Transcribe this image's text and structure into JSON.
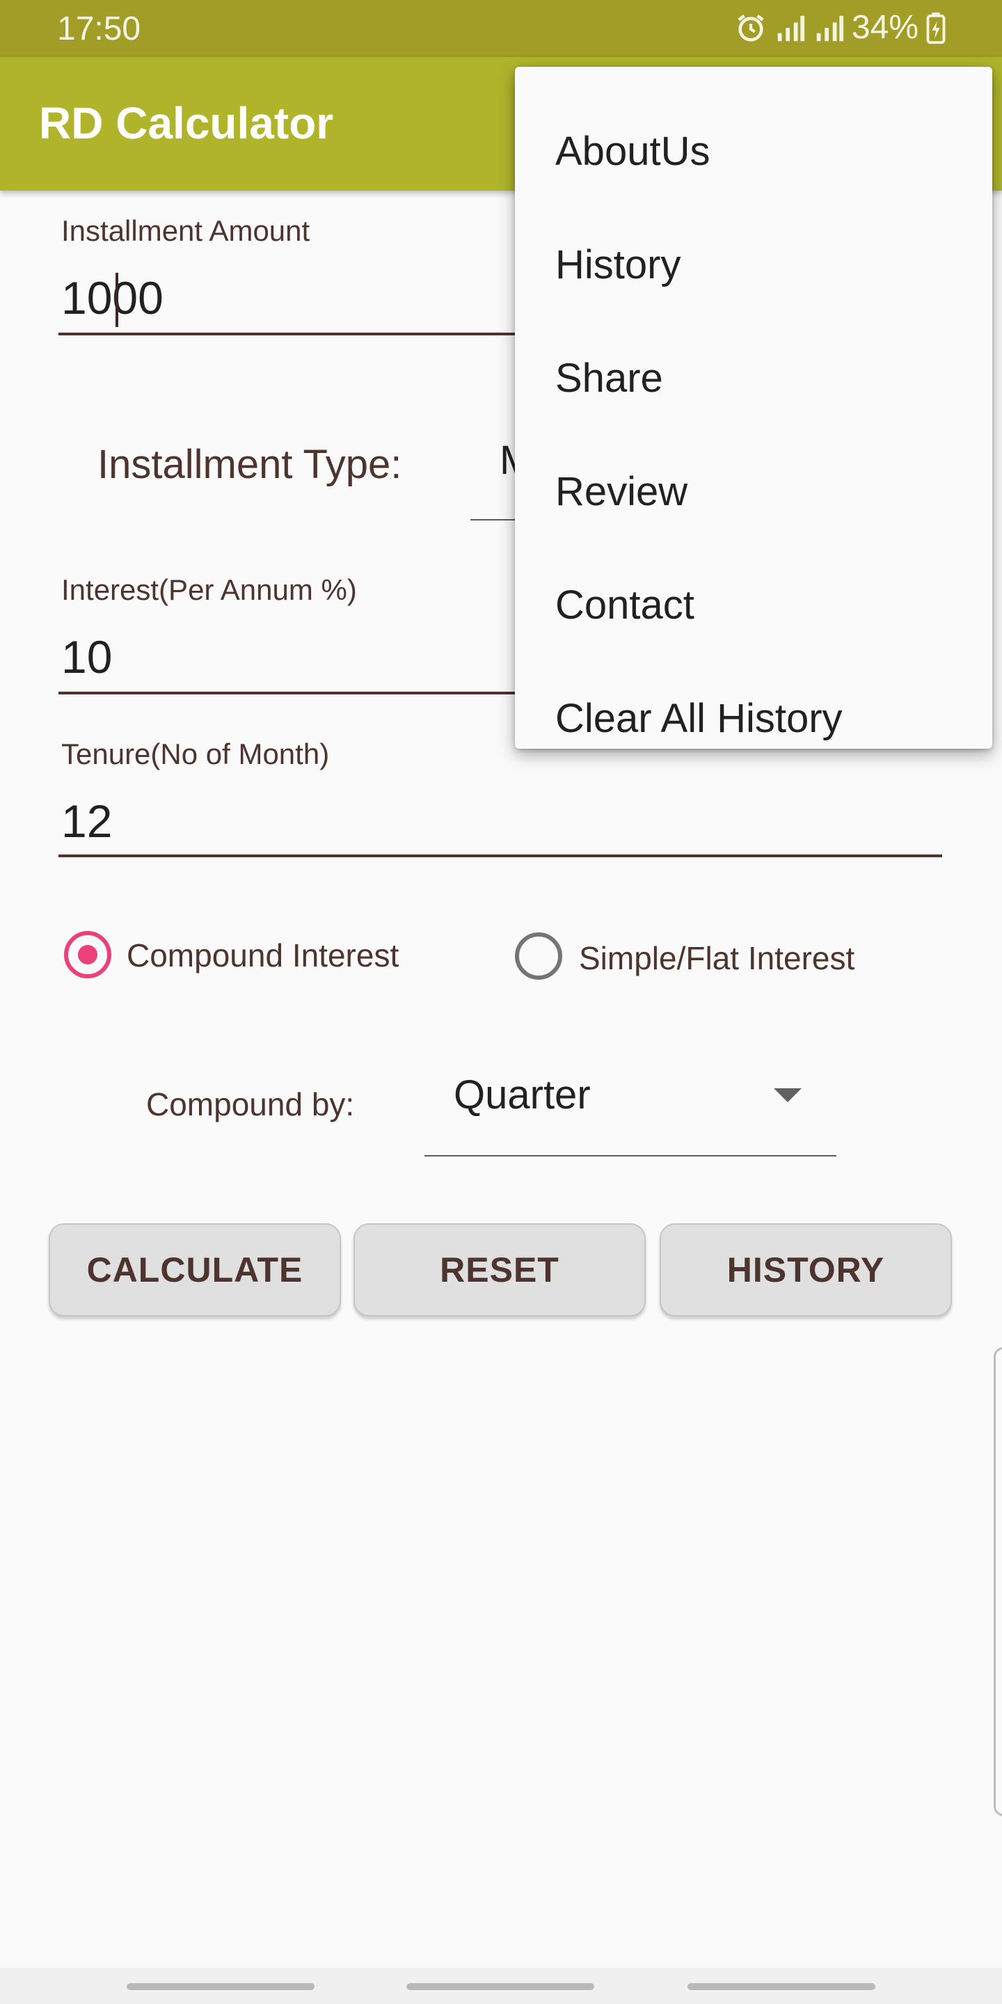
{
  "status_bar": {
    "time": "17:50",
    "battery": "34%"
  },
  "app_bar": {
    "title": "RD Calculator"
  },
  "form": {
    "installment_amount": {
      "label": "Installment Amount",
      "value": "1000"
    },
    "installment_type": {
      "label": "Installment Type:",
      "value": "M"
    },
    "interest": {
      "label": "Interest(Per Annum %)",
      "value": "10"
    },
    "tenure": {
      "label": "Tenure(No of Month)",
      "value": "12"
    },
    "interest_mode": {
      "options": [
        {
          "label": "Compound Interest",
          "selected": true
        },
        {
          "label": "Simple/Flat Interest",
          "selected": false
        }
      ]
    },
    "compound_by": {
      "label": "Compound by:",
      "value": "Quarter"
    }
  },
  "buttons": {
    "calculate": "CALCULATE",
    "reset": "RESET",
    "history": "HISTORY"
  },
  "overflow_menu": {
    "items": [
      "AboutUs",
      "History",
      "Share",
      "Review",
      "Contact",
      "Clear All History"
    ]
  },
  "colors": {
    "status_bar": "#a19d26",
    "app_bar": "#afb42b",
    "accent": "#ec407a",
    "label_text": "#4e342e"
  },
  "icons": [
    "alarm-icon",
    "signal-icon",
    "signal-icon",
    "battery-charging-icon",
    "dropdown-arrow-icon"
  ]
}
